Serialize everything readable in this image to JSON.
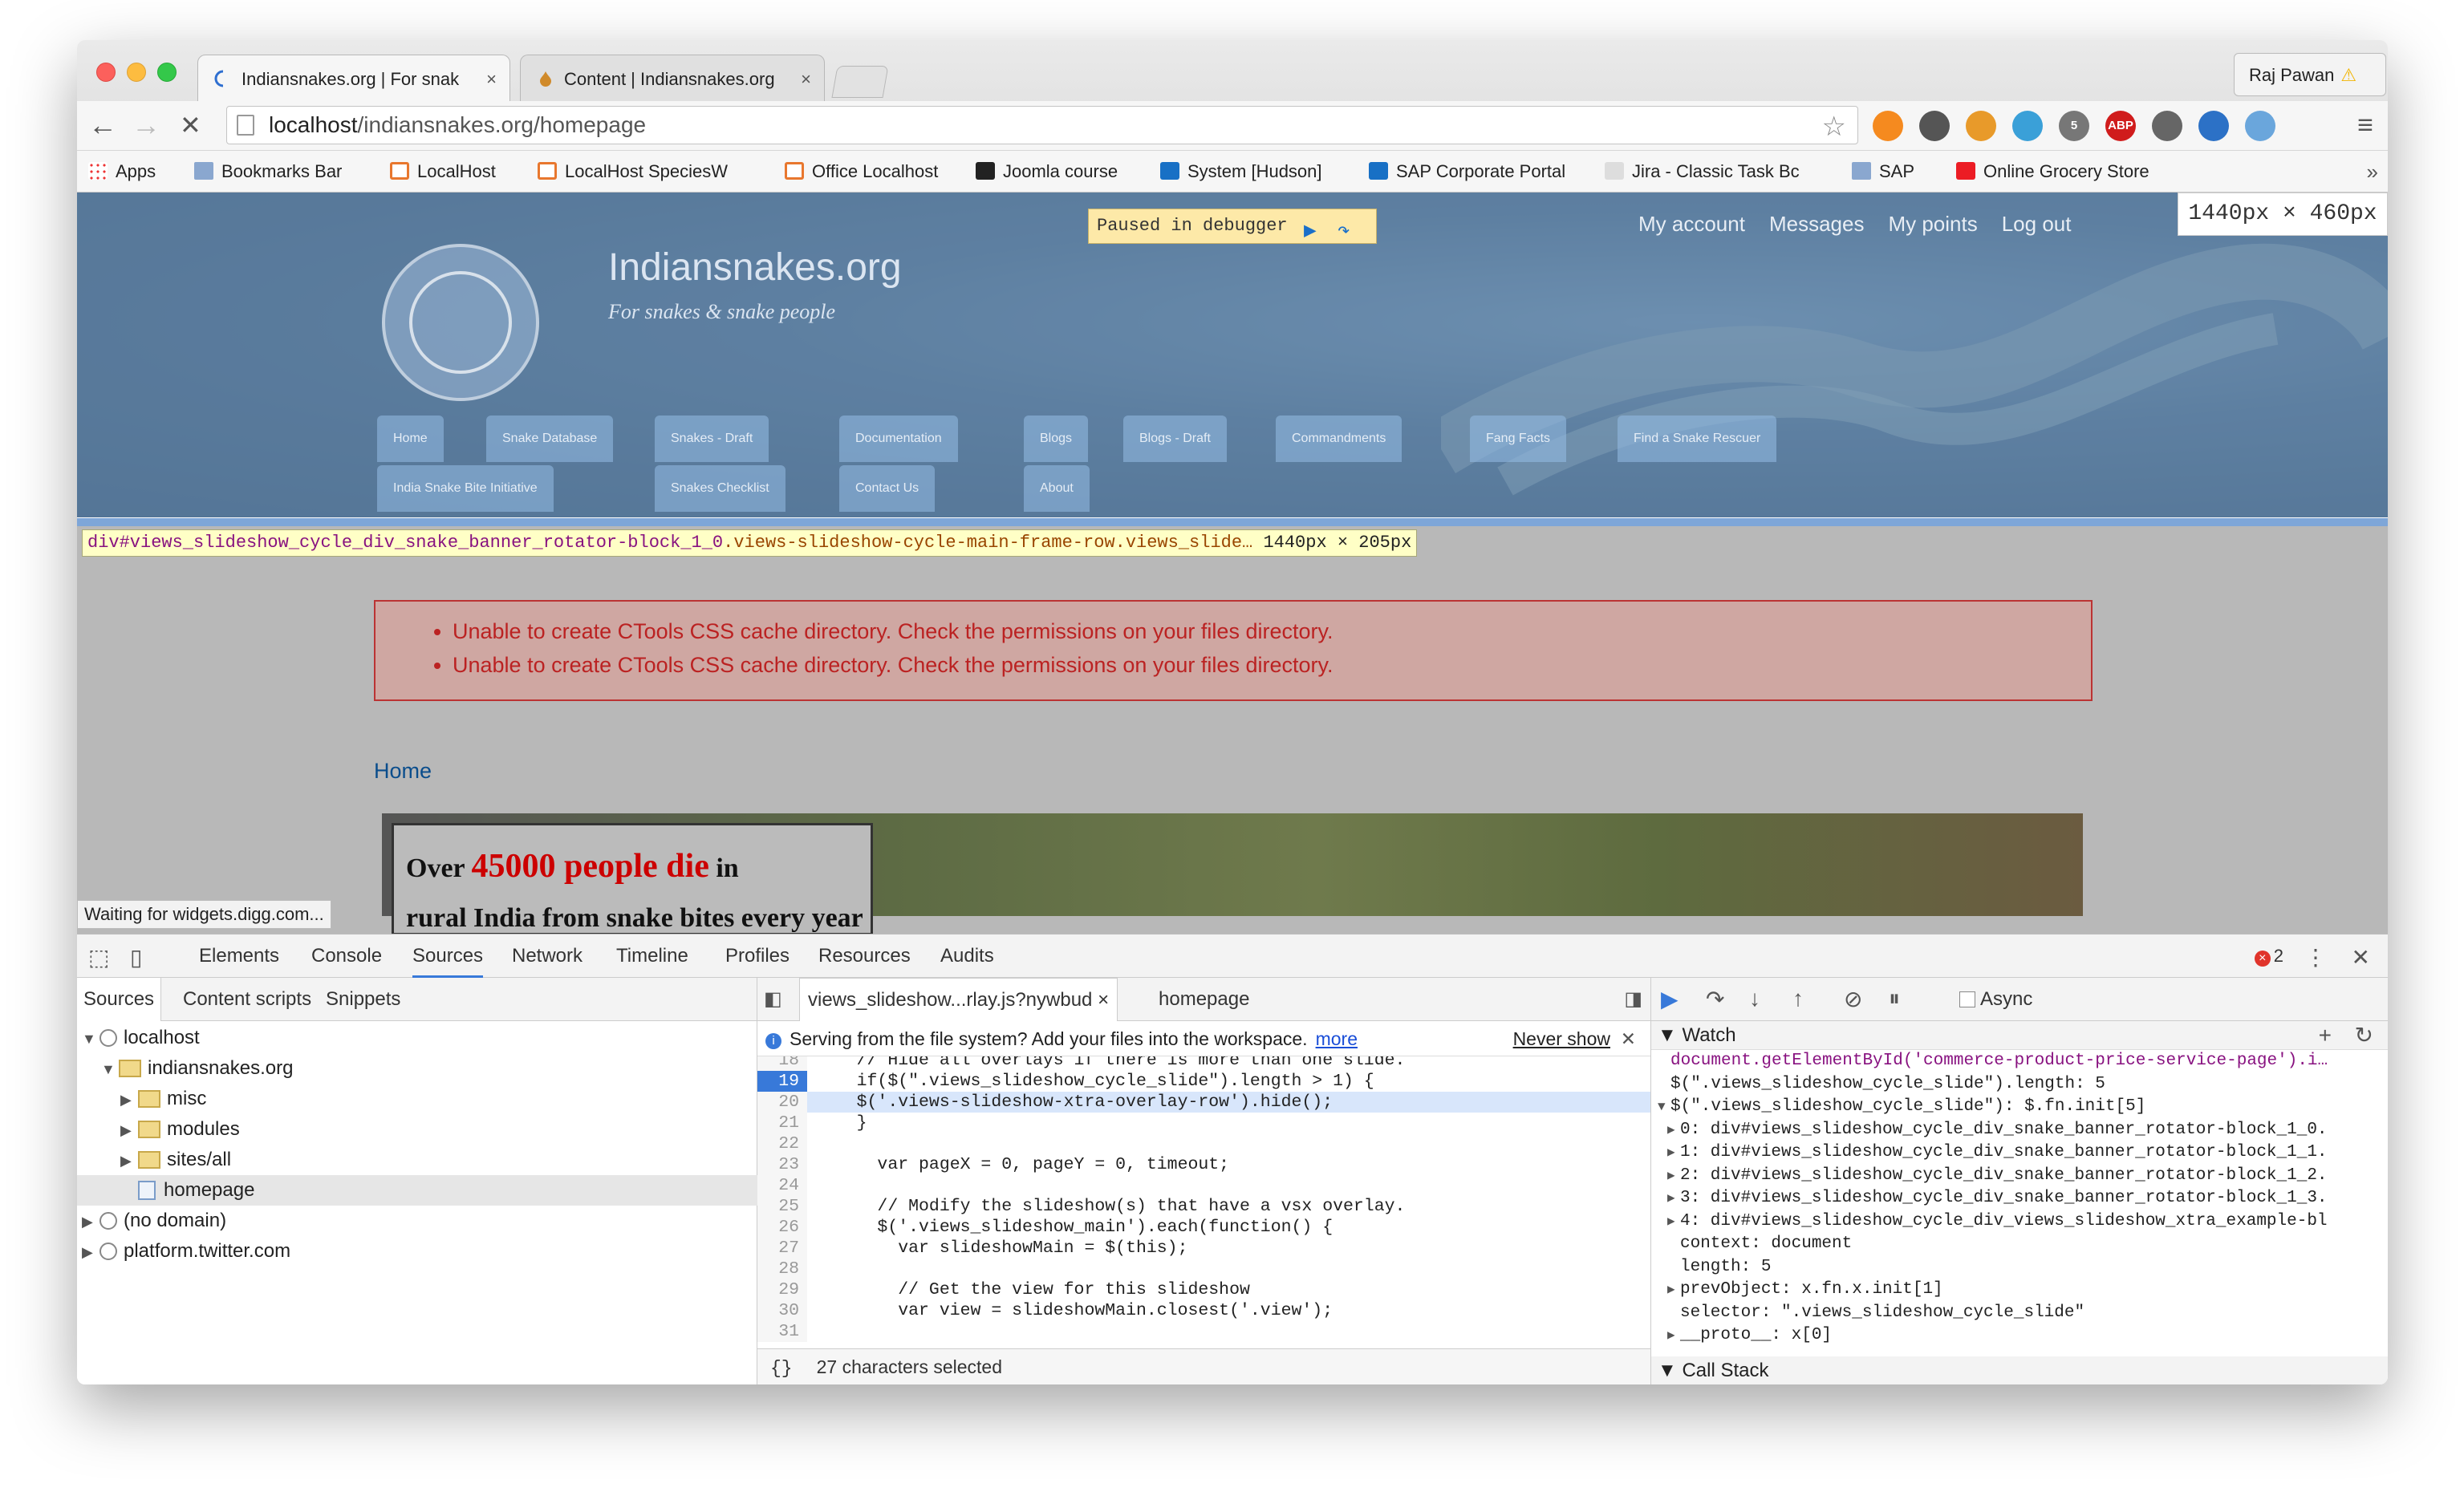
{
  "browser": {
    "tabs": [
      {
        "label": "Indiansnakes.org | For snak",
        "close": "×"
      },
      {
        "label": "Content | Indiansnakes.org",
        "close": "×"
      }
    ],
    "user": "Raj Pawan",
    "user_warn": "⚠",
    "back": "←",
    "forward": "→",
    "stop": "✕",
    "url_host": "localhost",
    "url_path": "/indiansnakes.org/homepage",
    "star": "☆",
    "extensions": [
      {
        "name": "rss-icon",
        "color": "#f58a1f",
        "label": ""
      },
      {
        "name": "bug-extension-icon",
        "color": "#555555",
        "label": ""
      },
      {
        "name": "speed-extension-icon",
        "color": "#e89a2a",
        "label": ""
      },
      {
        "name": "pin-extension-icon",
        "color": "#3aa0d8",
        "label": ""
      },
      {
        "name": "badge-extension-icon",
        "color": "#777777",
        "label": "5"
      },
      {
        "name": "adblock-icon",
        "color": "#d01c1c",
        "label": "ABP"
      },
      {
        "name": "cast-icon",
        "color": "#666666",
        "label": ""
      },
      {
        "name": "download-icon",
        "color": "#2c71c6",
        "label": ""
      },
      {
        "name": "screen-extension-icon",
        "color": "#6aa6dc",
        "label": ""
      }
    ],
    "menu": "≡",
    "bookmarks": [
      {
        "label": "Apps",
        "icon": "grid"
      },
      {
        "label": "Bookmarks Bar",
        "icon": "folder"
      },
      {
        "label": "LocalHost",
        "icon": "orange"
      },
      {
        "label": "LocalHost SpeciesW",
        "icon": "orange"
      },
      {
        "label": "Office Localhost",
        "icon": "orange"
      },
      {
        "label": "Joomla course",
        "icon": "dark"
      },
      {
        "label": "System [Hudson]",
        "icon": "sap"
      },
      {
        "label": "SAP Corporate Portal",
        "icon": "sap"
      },
      {
        "label": "Jira - Classic Task Bc",
        "icon": "jira"
      },
      {
        "label": "SAP",
        "icon": "folder"
      },
      {
        "label": "Online Grocery Store",
        "icon": "grocery"
      }
    ],
    "bookmarks_more": "»"
  },
  "page": {
    "debugger_paused": "Paused in debugger",
    "viewport_dims": "1440px × 460px",
    "top_links": [
      "My account",
      "Messages",
      "My points",
      "Log out"
    ],
    "site_name": "Indiansnakes.org",
    "site_slogan": "For snakes & snake people",
    "nav_row1": [
      "Home",
      "Snake Database",
      "Snakes - Draft",
      "Documentation",
      "Blogs",
      "Blogs - Draft",
      "Commandments",
      "Fang Facts",
      "Find a Snake Rescuer"
    ],
    "nav_row2": [
      "India Snake Bite Initiative",
      "Snakes Checklist",
      "Contact Us",
      "About"
    ],
    "selector_id": "div#views_slideshow_cycle_div_snake_banner_rotator-block_1_0",
    "selector_cls": ".views-slideshow-cycle-main-frame-row.views_slide…",
    "selector_dims": " 1440px × 205px",
    "errors": [
      "Unable to create CTools CSS cache directory. Check the permissions on your files directory.",
      "Unable to create CTools CSS cache directory. Check the permissions on your files directory."
    ],
    "breadcrumb": "Home",
    "hero_pre": "Over ",
    "hero_red": "45000 people die",
    "hero_post": " in",
    "hero_line2": "rural India from snake bites every year",
    "status": "Waiting for widgets.digg.com..."
  },
  "devtools": {
    "tabs": [
      "Elements",
      "Console",
      "Sources",
      "Network",
      "Timeline",
      "Profiles",
      "Resources",
      "Audits"
    ],
    "error_count": "2",
    "error_badge": "×",
    "more": "⋮",
    "close": "✕",
    "left_tabs": [
      "Sources",
      "Content scripts",
      "Snippets"
    ],
    "tree": [
      {
        "label": "localhost",
        "type": "globe",
        "arrow": "▼",
        "indent": 0
      },
      {
        "label": "indiansnakes.org",
        "type": "folder",
        "arrow": "▼",
        "indent": 1
      },
      {
        "label": "misc",
        "type": "folder",
        "arrow": "▶",
        "indent": 2
      },
      {
        "label": "modules",
        "type": "folder",
        "arrow": "▶",
        "indent": 2
      },
      {
        "label": "sites/all",
        "type": "folder",
        "arrow": "▶",
        "indent": 2
      },
      {
        "label": "homepage",
        "type": "file",
        "arrow": "",
        "indent": 2
      },
      {
        "label": "(no domain)",
        "type": "globe",
        "arrow": "▶",
        "indent": 0
      },
      {
        "label": "platform.twitter.com",
        "type": "globe",
        "arrow": "▶",
        "indent": 0
      }
    ],
    "file_tabs": [
      "views_slideshow...rlay.js?nywbud",
      "homepage"
    ],
    "file_tab_close": "×",
    "info_text": "Serving from the file system? Add your files into the workspace.",
    "info_more": "more",
    "info_never": "Never show",
    "info_close": "✕",
    "code_lines": [
      {
        "n": "18",
        "t": "    // Hide all overlays if there is more than one slide."
      },
      {
        "n": "19",
        "t": "    if($(\".views_slideshow_cycle_slide\").length > 1) {"
      },
      {
        "n": "20",
        "t": "    $('.views-slideshow-xtra-overlay-row').hide();"
      },
      {
        "n": "21",
        "t": "    }"
      },
      {
        "n": "22",
        "t": ""
      },
      {
        "n": "23",
        "t": "      var pageX = 0, pageY = 0, timeout;"
      },
      {
        "n": "24",
        "t": ""
      },
      {
        "n": "25",
        "t": "      // Modify the slideshow(s) that have a vsx overlay."
      },
      {
        "n": "26",
        "t": "      $('.views_slideshow_main').each(function() {"
      },
      {
        "n": "27",
        "t": "        var slideshowMain = $(this);"
      },
      {
        "n": "28",
        "t": ""
      },
      {
        "n": "29",
        "t": "        // Get the view for this slideshow"
      },
      {
        "n": "30",
        "t": "        var view = slideshowMain.closest('.view');"
      },
      {
        "n": "31",
        "t": ""
      }
    ],
    "code_status_braces": "{}",
    "code_status": "27 characters selected",
    "async_label": "Async",
    "watch_title": "Watch",
    "watch_add": "+",
    "watch_refresh": "↻",
    "watch_lines": [
      "document.getElementById('commerce-product-price-service-page').i…",
      "$(\".views_slideshow_cycle_slide\").length: 5",
      "$(\".views_slideshow_cycle_slide\"): $.fn.init[5]",
      "0: div#views_slideshow_cycle_div_snake_banner_rotator-block_1_0.",
      "1: div#views_slideshow_cycle_div_snake_banner_rotator-block_1_1.",
      "2: div#views_slideshow_cycle_div_snake_banner_rotator-block_1_2.",
      "3: div#views_slideshow_cycle_div_snake_banner_rotator-block_1_3.",
      "4: div#views_slideshow_cycle_div_views_slideshow_xtra_example-bl",
      "context: document",
      "length: 5",
      "prevObject: x.fn.x.init[1]",
      "selector: \".views_slideshow_cycle_slide\"",
      "__proto__: x[0]"
    ],
    "callstack_title": "Call Stack"
  }
}
